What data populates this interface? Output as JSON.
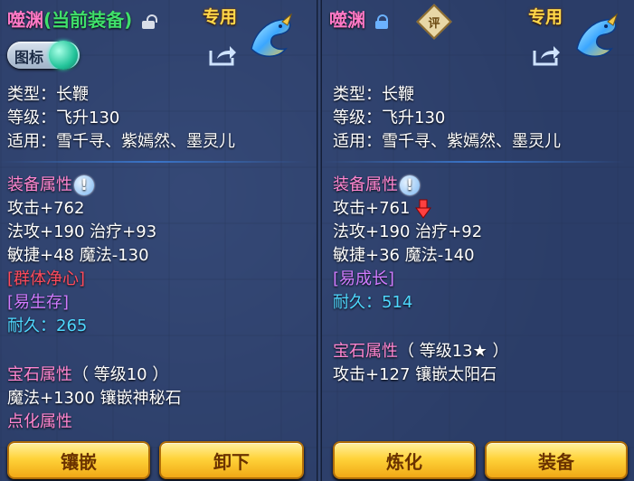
{
  "left": {
    "item_name": "噬渊",
    "equip_status": "(当前装备)",
    "exclusive_tag": "专用",
    "icon_toggle_label": "图标",
    "type_line": "类型：长鞭",
    "level_line": "等级：飞升130",
    "applies_line": "适用：雪千寻、紫嫣然、墨灵儿",
    "attr_title": "装备属性",
    "attrs": [
      "攻击+762",
      "法攻+190 治疗+93",
      "敏捷+48 魔法-130"
    ],
    "special_effect": "[群体净心]",
    "special_effect2": "[易生存]",
    "durability": "耐久：265",
    "gem_title": "宝石属性",
    "gem_level": "（ 等级10 ）",
    "gem_line": "魔法+1300 镶嵌神秘石",
    "refine_title": "点化属性",
    "btn_inlay": "镶嵌",
    "btn_unequip": "卸下"
  },
  "right": {
    "item_name": "噬渊",
    "review_badge": "评",
    "exclusive_tag": "专用",
    "type_line": "类型：长鞭",
    "level_line": "等级：飞升130",
    "applies_line": "适用：雪千寻、紫嫣然、墨灵儿",
    "attr_title": "装备属性",
    "attrs": [
      "攻击+761",
      "法攻+190 治疗+92",
      "敏捷+36 魔法-140"
    ],
    "special_effect": "[易成长]",
    "durability": "耐久：514",
    "gem_title": "宝石属性",
    "gem_level": "（ 等级13★ ）",
    "gem_line": "攻击+127 镶嵌太阳石",
    "btn_refine": "炼化",
    "btn_equip": "装备"
  },
  "colors": {
    "name": "#ff79c6",
    "equipped": "#3fe06a",
    "exclusive": "#ffd84a",
    "section": "#ff86d0",
    "effect_red": "#ff4b5c",
    "effect_purple": "#d07bff",
    "durability": "#4fd8ff",
    "button": "#ffd33a"
  }
}
